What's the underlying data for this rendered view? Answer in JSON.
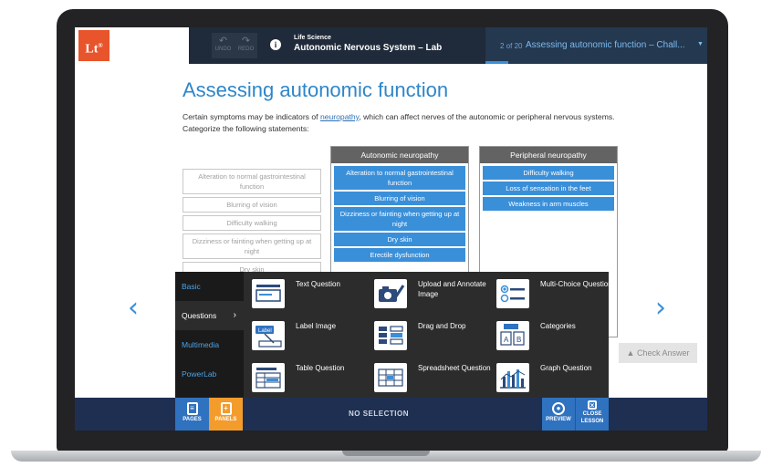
{
  "header": {
    "logo": "Lt",
    "logo_mark": "®",
    "undo_label": "UNDO",
    "redo_label": "REDO",
    "lab_subtitle": "Life Science",
    "lab_title": "Autonomic Nervous System – Lab",
    "page_count": "2 of 20",
    "page_title": "Assessing autonomic function – Chall..."
  },
  "content": {
    "heading": "Assessing autonomic function",
    "intro_before": "Certain symptoms may be indicators of ",
    "intro_link": "neuropathy",
    "intro_after": ", which can affect nerves of the autonomic or peripheral nervous systems. Categorize the following statements:",
    "source_items": [
      "Alteration to normal gastrointestinal function",
      "Blurring of vision",
      "Difficulty walking",
      "Dizziness or fainting when getting up at night",
      "Dry skin"
    ],
    "categories": [
      {
        "title": "Autonomic neuropathy",
        "items": [
          "Alteration to normal gastrointestinal function",
          "Blurring of vision",
          "Dizziness or fainting when getting up at night",
          "Dry skin",
          "Erectile dysfunction"
        ]
      },
      {
        "title": "Peripheral neuropathy",
        "items": [
          "Difficulty walking",
          "Loss of sensation in the feet",
          "Weakness in arm muscles"
        ]
      }
    ],
    "check_answer": "Check Answer",
    "prev_arrow": "‹",
    "next_arrow": "›"
  },
  "panel": {
    "side": [
      "Basic",
      "Questions",
      "Multimedia",
      "PowerLab"
    ],
    "active_side": "Questions",
    "tiles": [
      "Text Question",
      "Upload and Annotate Image",
      "Multi-Choice Question",
      "Label Image",
      "Drag and Drop",
      "Categories",
      "Table Question",
      "Spreadsheet Question",
      "Graph Question"
    ],
    "icon_label_text": "Label",
    "icon_cat_a": "A",
    "icon_cat_b": "B"
  },
  "bottombar": {
    "pages": "PAGES",
    "panels": "PANELS",
    "status": "NO SELECTION",
    "preview": "PREVIEW",
    "close_line1": "CLOSE",
    "close_line2": "LESSON"
  },
  "colors": {
    "accent": "#3a8fd9",
    "logo": "#e8542b",
    "panels_button": "#f39c2b",
    "topbar": "#1f2a3a",
    "bottombar": "#1e2f52"
  }
}
